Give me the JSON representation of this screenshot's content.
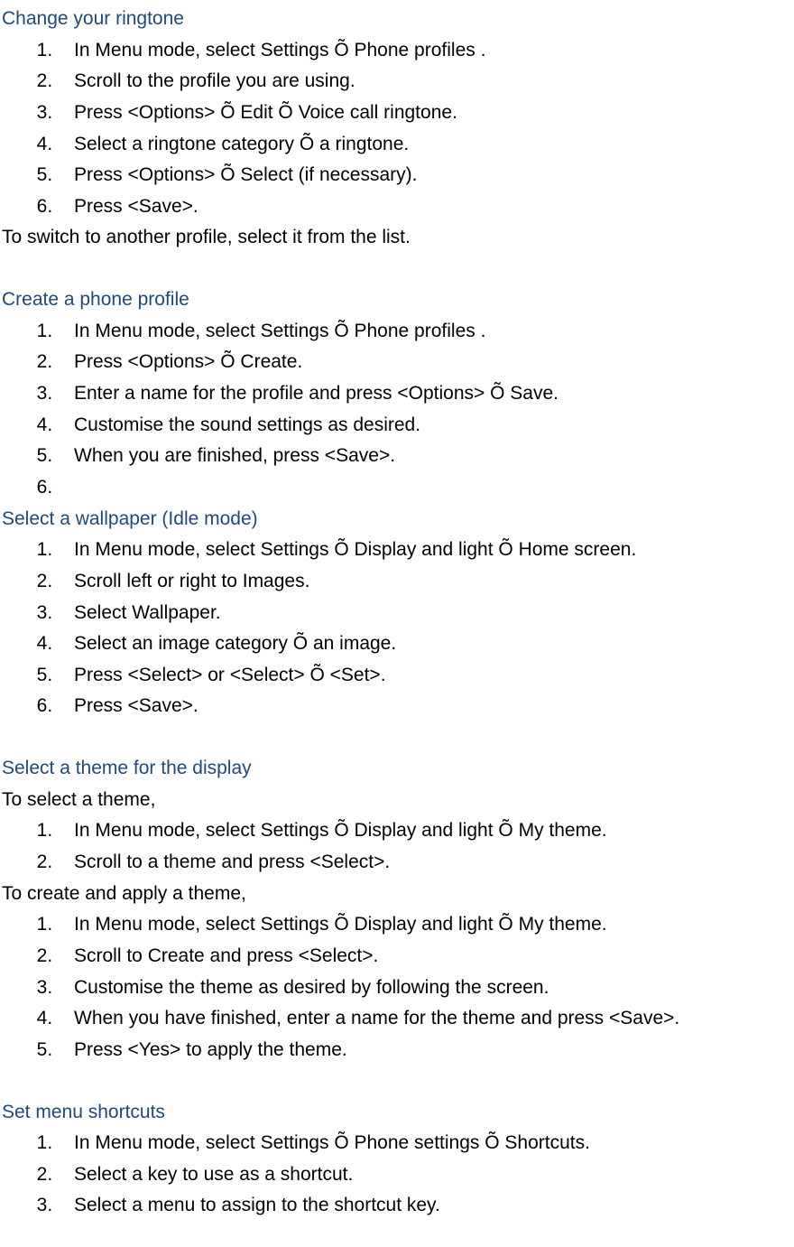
{
  "sections": {
    "s1": {
      "heading": "Change your ringtone",
      "items": [
        "In Menu mode, select Settings Õ Phone profiles .",
        "Scroll to the profile you are using.",
        "Press <Options> Õ Edit Õ Voice call ringtone.",
        "Select a ringtone category Õ a ringtone.",
        "Press <Options> Õ Select (if necessary).",
        "Press <Save>."
      ],
      "after": "To switch to another profile, select it from the list."
    },
    "s2": {
      "heading": "Create a phone profile",
      "items": [
        "In Menu mode, select Settings Õ Phone profiles .",
        "Press <Options> Õ Create.",
        "Enter a name for the profile and press <Options> Õ Save.",
        "Customise the sound settings as desired.",
        "When you are finished, press <Save>.",
        ""
      ]
    },
    "s3": {
      "heading": "Select a wallpaper (Idle mode)",
      "items": [
        "In Menu mode, select Settings Õ Display and light Õ Home screen.",
        "Scroll left or right to Images.",
        "Select Wallpaper.",
        "Select an image category Õ an image.",
        "Press <Select> or <Select> Õ <Set>.",
        "Press <Save>."
      ]
    },
    "s4": {
      "heading": "Select a theme for the display",
      "intro": "To select a theme,",
      "items1": [
        "In Menu mode, select Settings Õ Display and light Õ My theme.",
        "Scroll to a theme and press <Select>."
      ],
      "mid": "To create and apply a theme,",
      "items2": [
        "In Menu mode, select Settings Õ Display and light Õ My theme.",
        "Scroll to Create and press <Select>.",
        "Customise the theme as desired by following the screen.",
        "When you have finished, enter a name for the theme and press <Save>.",
        "Press <Yes> to apply the theme."
      ]
    },
    "s5": {
      "heading": "Set menu shortcuts",
      "items": [
        "In Menu mode, select Settings Õ Phone settings Õ Shortcuts.",
        "Select a key to use as a shortcut.",
        "Select a menu to assign to the shortcut key."
      ]
    }
  }
}
